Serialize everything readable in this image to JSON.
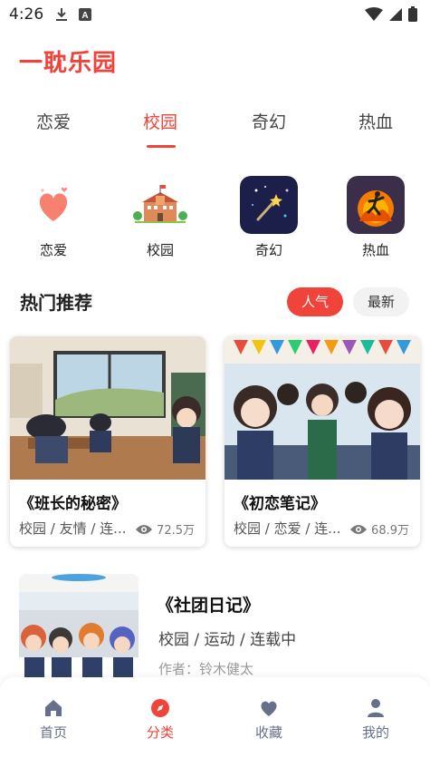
{
  "status_bar": {
    "time": "4:26",
    "left_icons": [
      "download-icon",
      "text-a-icon"
    ],
    "right_icons": [
      "wifi-icon",
      "signal-icon",
      "battery-icon"
    ]
  },
  "app": {
    "title": "一耽乐园",
    "accent": "#f0433a"
  },
  "tabs": [
    {
      "label": "恋爱",
      "active": false
    },
    {
      "label": "校园",
      "active": true
    },
    {
      "label": "奇幻",
      "active": false
    },
    {
      "label": "热血",
      "active": false
    }
  ],
  "categories": [
    {
      "label": "恋爱",
      "icon": "heart-icon"
    },
    {
      "label": "校园",
      "icon": "school-building-icon"
    },
    {
      "label": "奇幻",
      "icon": "magic-wand-icon"
    },
    {
      "label": "热血",
      "icon": "fire-runner-icon"
    }
  ],
  "section": {
    "title": "热门推荐",
    "sort_hot": "人气",
    "sort_new": "最新"
  },
  "cards": [
    {
      "title": "《班长的秘密》",
      "tags": "校园 / 友情 / 连...",
      "views": "72.5万"
    },
    {
      "title": "《初恋笔记》",
      "tags": "校园 / 恋爱 / 连...",
      "views": "68.9万"
    }
  ],
  "list_item": {
    "title": "《社团日记》",
    "tags": "校园 / 运动 / 连载中",
    "author": "作者：铃木健太"
  },
  "bottom_nav": [
    {
      "label": "首页",
      "icon": "home-icon",
      "active": false
    },
    {
      "label": "分类",
      "icon": "compass-icon",
      "active": true
    },
    {
      "label": "收藏",
      "icon": "heart-icon",
      "active": false
    },
    {
      "label": "我的",
      "icon": "user-icon",
      "active": false
    }
  ]
}
